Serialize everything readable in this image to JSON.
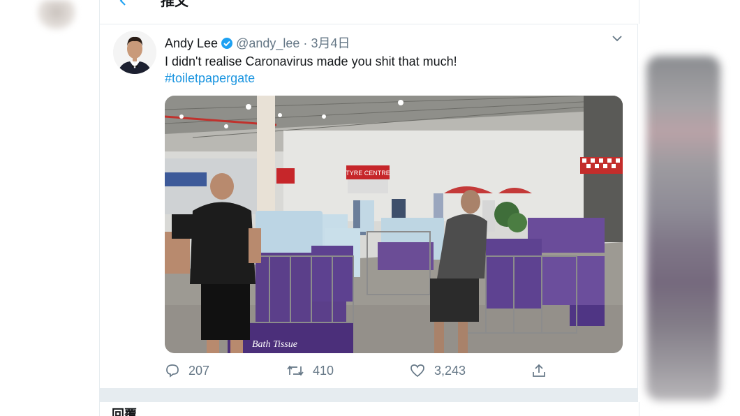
{
  "header": {
    "title": "推文",
    "back_icon": "arrow-left-icon"
  },
  "tweet": {
    "author_name": "Andy Lee",
    "handle": "@andy_lee",
    "separator": "·",
    "date": "3月4日",
    "text": "I didn't realise Caronavirus made you shit that much!",
    "hashtag": "#toiletpapergate",
    "photo": {
      "signs": [
        "TYRE CENTRE"
      ],
      "shelf_label": "Bath Tissue"
    },
    "actions": {
      "replies": "207",
      "retweets": "410",
      "likes": "3,243"
    }
  },
  "reply_section": {
    "label": "回覆"
  },
  "colors": {
    "accent": "#1da1f2",
    "hashtag": "#1b95e0",
    "muted": "#657786",
    "border": "#e6ecf0"
  }
}
